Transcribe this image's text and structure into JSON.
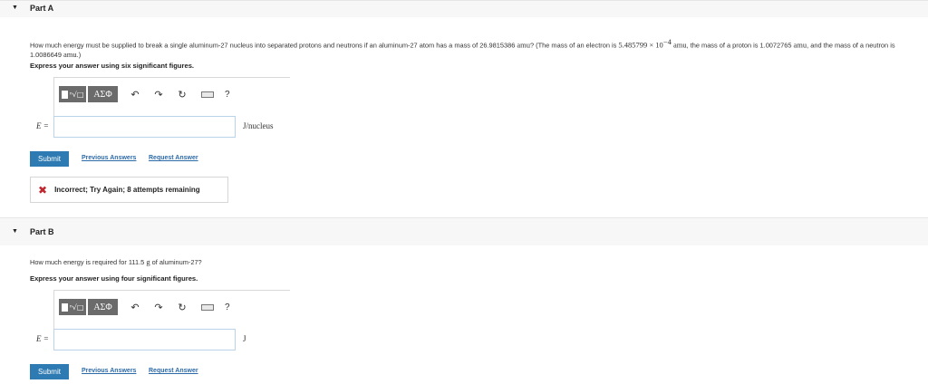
{
  "partA": {
    "title": "Part A",
    "question_pre": "How much energy must be supplied to break a single aluminum-27 nucleus into separated protons and neutrons if an aluminum-27 atom has a mass of 26.9815386 ",
    "unit_amu": "amu",
    "question_mid": "? (The mass of an electron is ",
    "electron_mass": "5.485799 × 10",
    "electron_exp": "−4",
    "question_mid2": " amu",
    "question_mid3": ", the mass of a proton is 1.0072765 ",
    "question_mid4": "amu",
    "question_mid5": ", and the mass of a neutron is 1.0086649 ",
    "question_mid6": "amu",
    "question_end": ".)",
    "instruction": "Express your answer using six significant figures.",
    "variable": "E =",
    "unit": "J/nucleus",
    "input_value": "",
    "submit_label": "Submit",
    "previous_answers": "Previous Answers",
    "request_answer": "Request Answer",
    "feedback_text": "Incorrect; Try Again; 8 attempts remaining"
  },
  "partB": {
    "title": "Part B",
    "question_pre": "How much energy is required for 111.5 ",
    "unit_g": "g",
    "question_end": " of aluminum-27?",
    "instruction": "Express your answer using four significant figures.",
    "variable": "E =",
    "unit": "J",
    "input_value": "",
    "submit_label": "Submit",
    "previous_answers": "Previous Answers",
    "request_answer": "Request Answer"
  },
  "toolbar": {
    "greek_label": "ΑΣΦ",
    "help_label": "?",
    "icons": [
      "templates-icon",
      "greek-letters-icon",
      "undo-icon",
      "redo-icon",
      "reset-icon",
      "keyboard-icon",
      "help-icon"
    ]
  },
  "colors": {
    "submit_bg": "#2e7bb3",
    "link": "#2d6ba8",
    "incorrect": "#c0262d",
    "header_bg": "#f7f7f7"
  }
}
